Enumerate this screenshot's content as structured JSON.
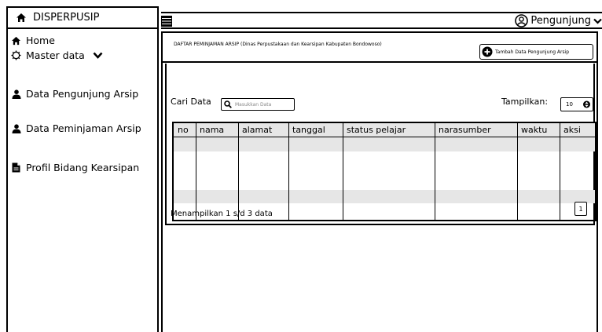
{
  "sidebar": {
    "brand": "DISPERPUSIP",
    "items": [
      {
        "label": "Home",
        "icon": "home-icon"
      },
      {
        "label": "Master data",
        "icon": "settings-icon"
      },
      {
        "label": "Data Pengunjung  Arsip",
        "icon": "user-icon"
      },
      {
        "label": "Data Peminjaman  Arsip",
        "icon": "user-icon"
      },
      {
        "label": "Profil Bidang Kearsipan",
        "icon": "document-icon"
      }
    ]
  },
  "header": {
    "user_label": "Pengunjung"
  },
  "main": {
    "title": "DAFTAR PEMINJAMAN ARSIP (Dinas Perpustakaan dan Kearsipan Kabupaten Bondowoso)",
    "add_button": "Tambah Data Pengunjung Arsip",
    "search_label": "Cari Data",
    "search_placeholder": "Masukkan Data",
    "show_label": "Tampilkan:",
    "show_value": "10",
    "table": {
      "columns": [
        "no",
        "nama",
        "alamat",
        "tanggal",
        "status pelajar",
        "narasumber",
        "waktu",
        "aksi"
      ],
      "rows": []
    },
    "footer_text": "Menampilkan 1 s/d 3 data",
    "page": "1"
  }
}
